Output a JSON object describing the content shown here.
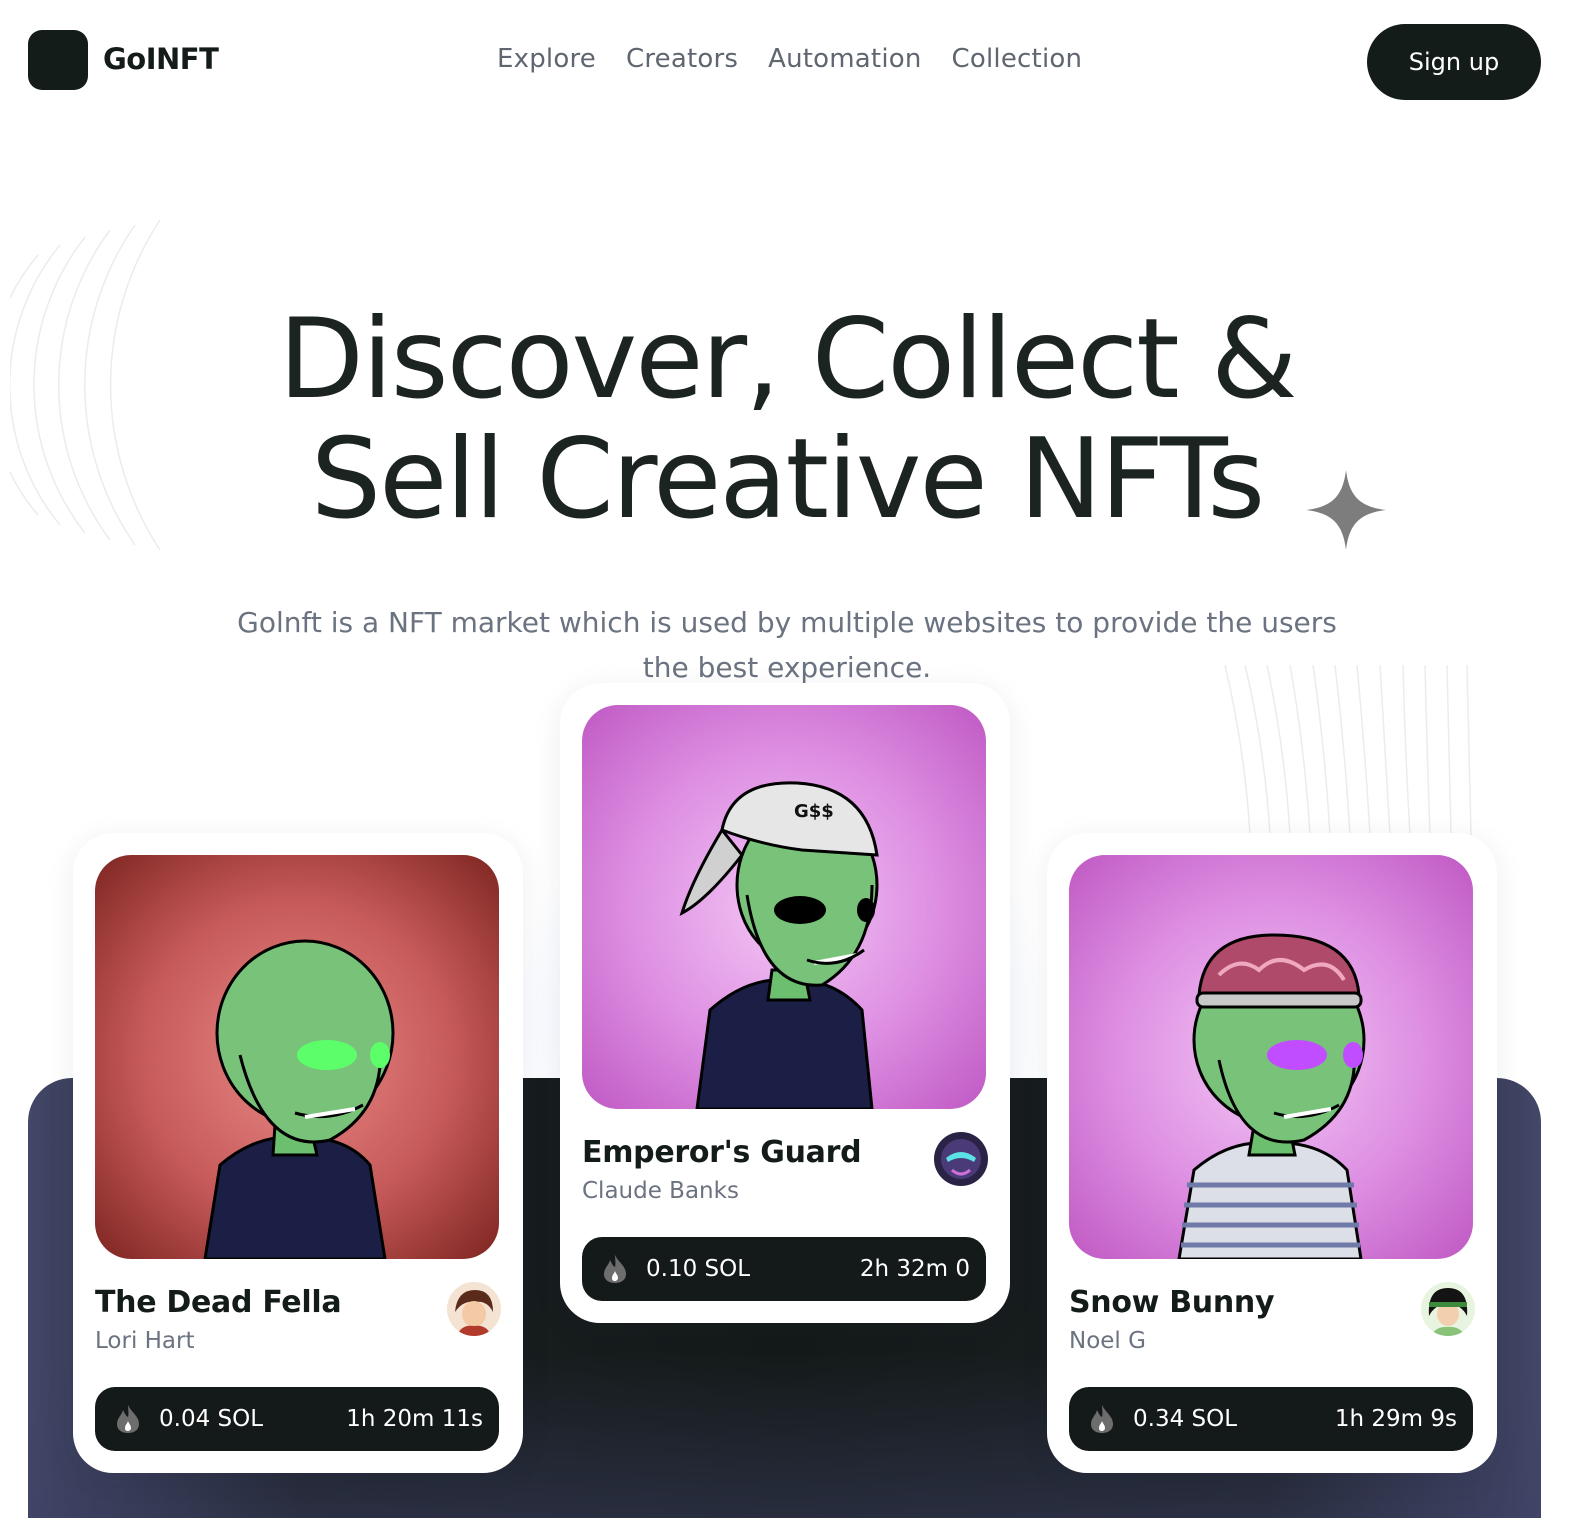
{
  "header": {
    "logo_text": "GoINFT",
    "nav": [
      "Explore",
      "Creators",
      "Automation",
      "Collection"
    ],
    "signup_label": "Sign up"
  },
  "hero": {
    "title_line1": "Discover, Collect &",
    "title_line2": "Sell Creative NFTs",
    "subtitle": "Golnft is a NFT market which is used by multiple websites to provide the users the best experience."
  },
  "cards": [
    {
      "name": "The Dead Fella",
      "creator": "Lori Hart",
      "price": "0.04 SOL",
      "timer": "1h 20m 11s",
      "art_bg": "#c65a5a",
      "eye_color": "#5cff6a"
    },
    {
      "name": "Emperor's Guard",
      "creator": "Claude Banks",
      "price": "0.10 SOL",
      "timer": "2h 32m 0",
      "art_bg": "#d783dd",
      "eye_color": "#000000",
      "cap_text": "G$$"
    },
    {
      "name": "Snow Bunny",
      "creator": "Noel G",
      "price": "0.34 SOL",
      "timer": "1h 29m 9s",
      "art_bg": "#d783dd",
      "eye_color": "#c04dff"
    }
  ],
  "icons": {
    "sparkle": "sparkle-icon",
    "flame": "flame-icon"
  },
  "colors": {
    "primary_dark": "#141c1a",
    "muted_text": "#6b7280",
    "band_edge": "#434768"
  }
}
